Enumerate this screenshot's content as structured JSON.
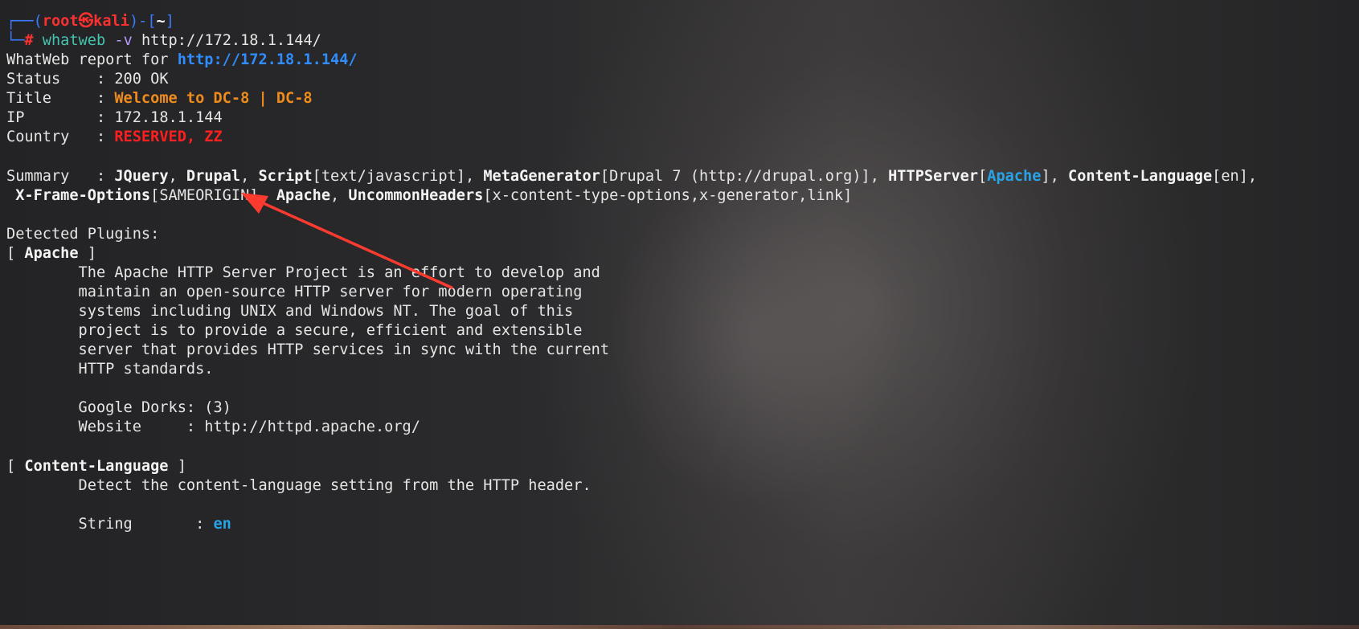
{
  "prompt": {
    "corner_top": "┌──(",
    "user": "root",
    "skull": "㉿",
    "host": "kali",
    "mid": ")-[",
    "cwd": "~",
    "close": "]",
    "corner_bottom": "└─",
    "hash": "#",
    "command": "whatweb",
    "option": "-v",
    "argument": "http://172.18.1.144/"
  },
  "report": {
    "header_prefix": "WhatWeb report for ",
    "url": "http://172.18.1.144/",
    "status_key": "Status    : ",
    "status_value": "200 OK",
    "title_key": "Title     : ",
    "title_value": "Welcome to DC-8 | DC-8",
    "ip_key": "IP        : ",
    "ip_value": "172.18.1.144",
    "country_key": "Country   : ",
    "country_value": "RESERVED, ZZ",
    "summary_key": "Summary   : ",
    "summary_line1": [
      {
        "t": "JQuery",
        "s": "b"
      },
      {
        "t": ", ",
        "s": ""
      },
      {
        "t": "Drupal",
        "s": "b"
      },
      {
        "t": ", ",
        "s": ""
      },
      {
        "t": "Script",
        "s": "b"
      },
      {
        "t": "[text/javascript], ",
        "s": ""
      },
      {
        "t": "MetaGenerator",
        "s": "b"
      },
      {
        "t": "[Drupal 7 (http://drupal.org)], ",
        "s": ""
      },
      {
        "t": "HTTPServer",
        "s": "b"
      },
      {
        "t": "[",
        "s": ""
      },
      {
        "t": "Apache",
        "s": "cyan"
      },
      {
        "t": "], ",
        "s": ""
      },
      {
        "t": "Content-Language",
        "s": "b"
      },
      {
        "t": "[en],",
        "s": ""
      }
    ],
    "summary_line2": [
      {
        "t": " ",
        "s": ""
      },
      {
        "t": "X-Frame-Options",
        "s": "b"
      },
      {
        "t": "[SAMEORIGIN], ",
        "s": ""
      },
      {
        "t": "Apache",
        "s": "b"
      },
      {
        "t": ", ",
        "s": ""
      },
      {
        "t": "UncommonHeaders",
        "s": "b"
      },
      {
        "t": "[x-content-type-options,x-generator,link]",
        "s": ""
      }
    ]
  },
  "plugins": {
    "heading": "Detected Plugins:",
    "apache": {
      "open": "[ ",
      "name": "Apache",
      "close": " ]",
      "description": [
        "        The Apache HTTP Server Project is an effort to develop and",
        "        maintain an open-source HTTP server for modern operating",
        "        systems including UNIX and Windows NT. The goal of this",
        "        project is to provide a secure, efficient and extensible",
        "        server that provides HTTP services in sync with the current",
        "        HTTP standards."
      ],
      "dorks": "        Google Dorks: (3)",
      "website": "        Website     : http://httpd.apache.org/"
    },
    "content_language": {
      "open": "[ ",
      "name": "Content-Language",
      "close": " ]",
      "description": "        Detect the content-language setting from the HTTP header.",
      "string_key": "        String       : ",
      "string_value": "en"
    }
  },
  "colors": {
    "prompt_frame": "#3b7bff",
    "prompt_user": "#ff3030",
    "url": "#2f8dff",
    "title_value": "#f08c1c",
    "country_value": "#ff1f1f",
    "highlight": "#29a3e8",
    "annotation_arrow": "#ff3b30"
  }
}
